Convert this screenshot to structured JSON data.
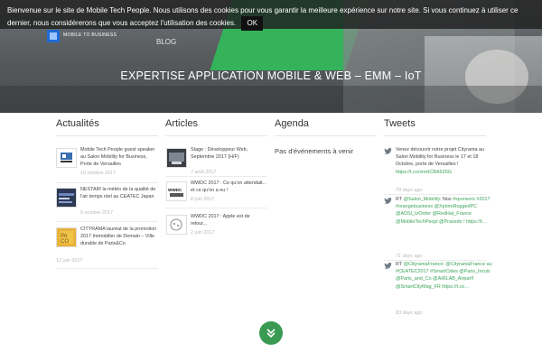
{
  "cookie": {
    "message": "Bienvenue sur le site de Mobile Tech People. Nous utilisons des cookies pour vous garantir la meilleure expérience sur notre site. Si vous continuez à utiliser ce dernier, nous considérerons que vous acceptez l'utilisation des cookies.",
    "ok_label": "OK"
  },
  "header": {
    "logo_tagline": "MOBILE TO BUSINESS",
    "nav_blog": "BLOG",
    "hero_title": "EXPERTISE APPLICATION MOBILE & WEB – EMM – IoT"
  },
  "actualites": {
    "title": "Actualités",
    "items": [
      {
        "text": "Mobile Tech People guest speaker au Salon Mobility for Business, Porte de Versailles",
        "date": "16 octobre 2017",
        "icon": "citybox-logo"
      },
      {
        "text": "NESTAIR la météo de la qualité de l'air temps réel au CEATEC Japan",
        "date": "6 octobre 2017",
        "icon": "nestair-thumb"
      },
      {
        "text": "CITYRAMA lauréat de la promotion 2017 Immobilier de Demain – Ville durable de Paris&Co",
        "date": "12 juin 2017",
        "icon": "parisco-logo"
      }
    ]
  },
  "articles": {
    "title": "Articles",
    "items": [
      {
        "text": "Stage : Développeur Web, Septembre 2017 (H/F)",
        "date": "7 août 2017",
        "icon": "stage-thumb"
      },
      {
        "text": "WWDC 2017 : Ce qu'on attendait... et ce qu'on a eu !",
        "date": "8 juin 2017",
        "icon": "wwdc-thumb"
      },
      {
        "text": "WWDC 2017 : Apple est de retour...",
        "date": "2 juin 2017",
        "icon": "apple-thumb"
      }
    ]
  },
  "agenda": {
    "title": "Agenda",
    "empty": "Pas d'événements à venir"
  },
  "tweets": {
    "title": "Tweets",
    "items": [
      {
        "text": "Venez découvrir notre projet Cityrama au Salon Mobility for Business le 17 et 18 Octobre, porte de Versailles !",
        "link": "https://t.co/xmHCBA5Z6G",
        "date": "70 days ago"
      },
      {
        "prefix": "RT",
        "link_start": "@Salon_Mobility:",
        "text": " Nos",
        "link": "#sponsors #2017 #orangebusiness @XploreRuggedPC @ADSI_IzOrder @RedHat_France @MobileTechPeopl @Praxedo ! https://t…",
        "date": "71 days ago"
      },
      {
        "prefix": "RT",
        "link": "@CityramaFrance: @CityramaFrance au #CEATEC2017 #SmartCities @Paris_Incub @Paris_and_Co @AIRLAB_AirparIf @SmartCityMag_FR https://t.co…",
        "date": "83 days ago"
      }
    ]
  },
  "colors": {
    "accent": "#3ca35a",
    "scroll_button": "#3a9a52"
  }
}
